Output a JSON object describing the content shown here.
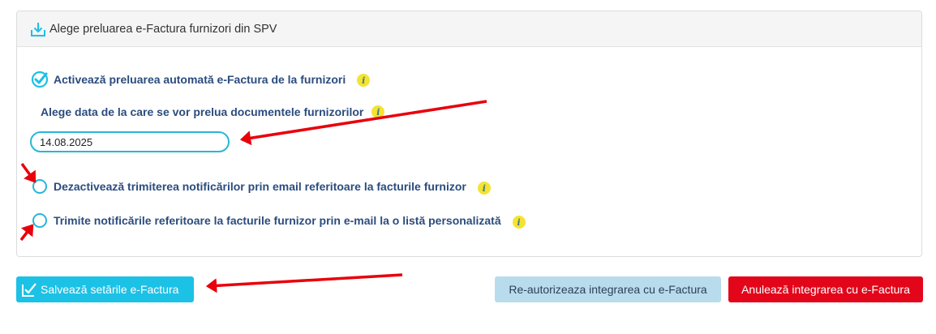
{
  "panel": {
    "title": "Alege preluarea e-Factura furnizori din SPV",
    "auto_fetch_label": "Activează preluarea automată e-Factura de la furnizori",
    "date_label": "Alege data de la care se vor prelua documentele furnizorilor",
    "date_value": "14.08.2025",
    "disable_notifications_label": "Dezactivează trimiterea notificărilor prin email referitoare la facturile furnizor",
    "custom_list_label": "Trimite notificările referitoare la facturile furnizor prin e-mail la o listă personalizată",
    "info_glyph": "i"
  },
  "buttons": {
    "save": "Salvează setările e-Factura",
    "reauthorize": "Re-autorizeaza integrarea cu e-Factura",
    "cancel": "Anulează integrarea cu e-Factura"
  },
  "colors": {
    "accent": "#1cc1e6",
    "danger": "#e3061b",
    "secondary": "#b9dced",
    "info": "#f5e332",
    "annotation_arrow": "#e8000b"
  },
  "icons": {
    "header": "download-icon",
    "checked": "check-circle-icon",
    "save": "check-square-icon",
    "info": "info-icon"
  },
  "state": {
    "auto_fetch_checked": true,
    "disable_notifications_selected": false,
    "custom_list_selected": false
  }
}
